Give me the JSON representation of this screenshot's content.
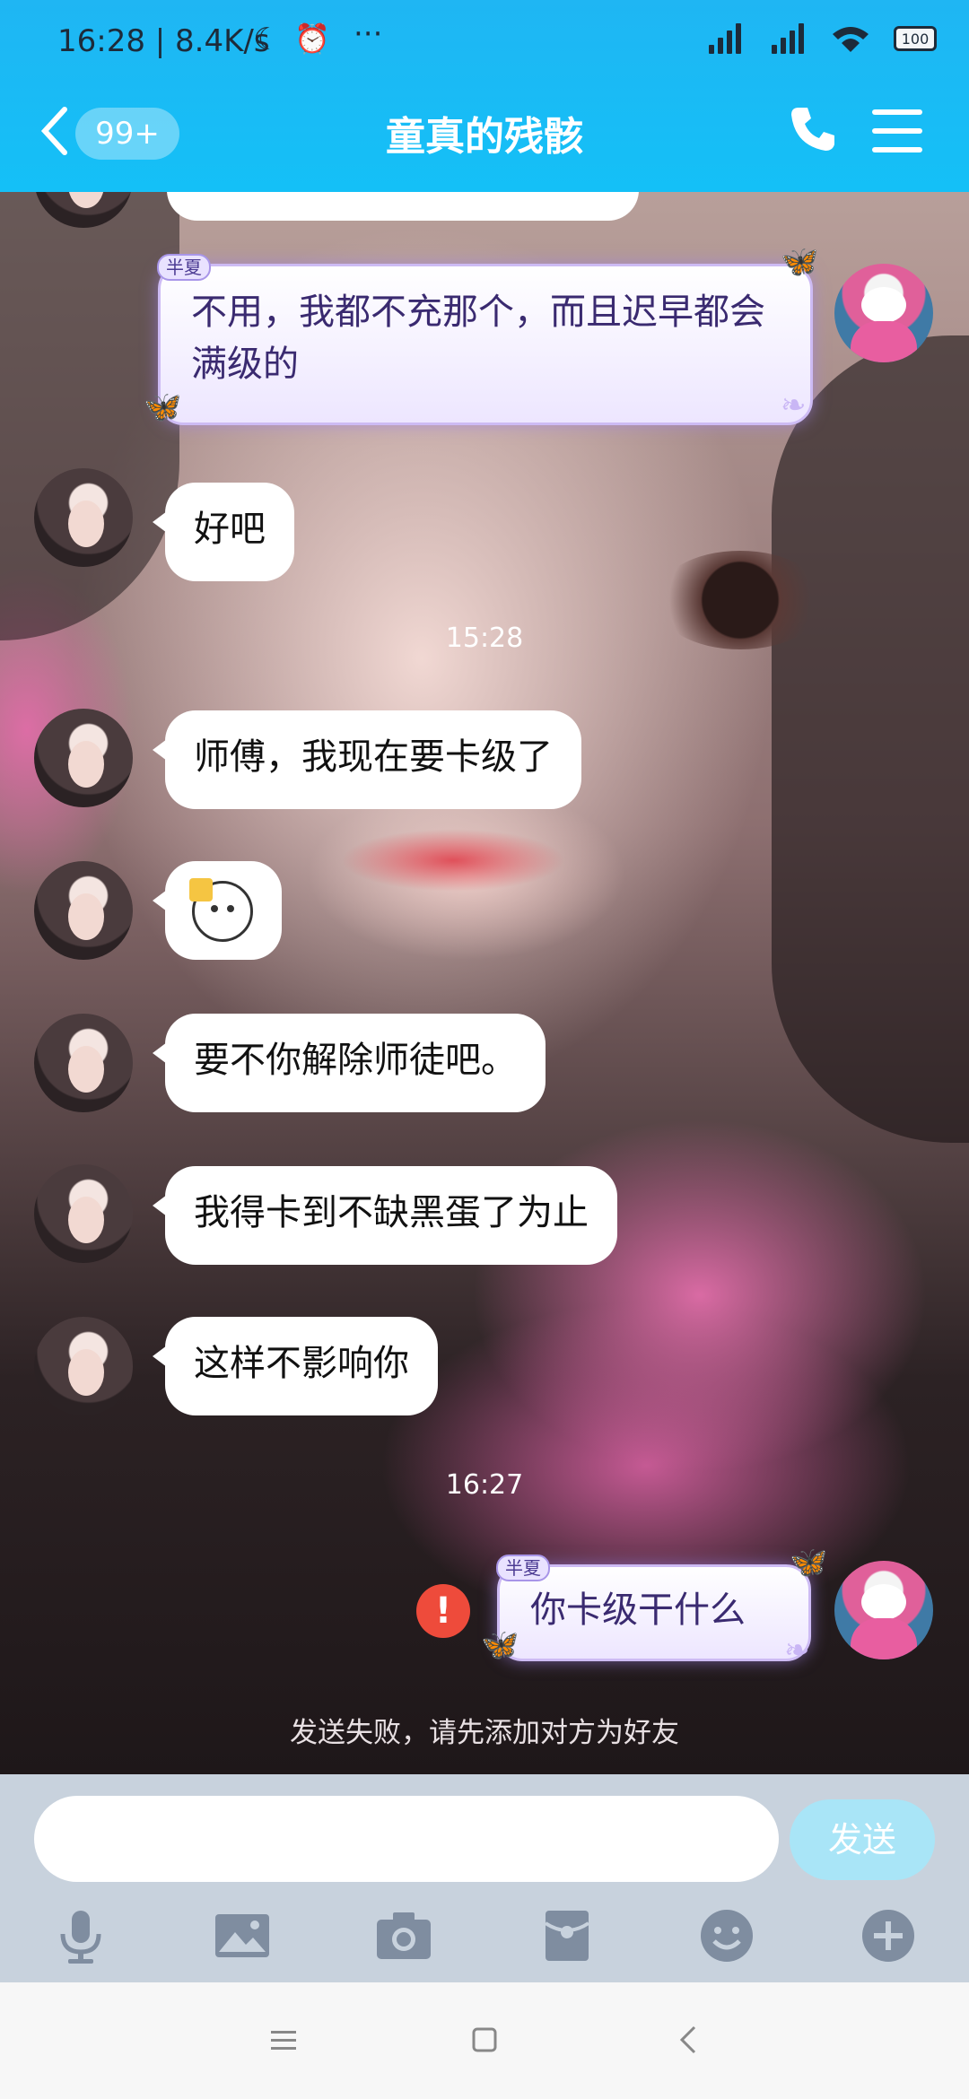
{
  "status_bar": {
    "time": "16:28 | 8.4K/s",
    "battery": "100"
  },
  "header": {
    "unread_badge": "99+",
    "title": "童真的残骸"
  },
  "messages": [
    {
      "side": "right",
      "tag": "半夏",
      "text": "不用，我都不充那个，而且迟早都会满级的"
    },
    {
      "side": "left",
      "text": "好吧"
    },
    {
      "type": "time",
      "text": "15:28"
    },
    {
      "side": "left",
      "text": "师傅，我现在要卡级了"
    },
    {
      "side": "left",
      "type": "sticker"
    },
    {
      "side": "left",
      "text": "要不你解除师徒吧。"
    },
    {
      "side": "left",
      "text": "我得卡到不缺黑蛋了为止"
    },
    {
      "side": "left",
      "text": "这样不影响你"
    },
    {
      "type": "time",
      "text": "16:27"
    },
    {
      "side": "right",
      "tag": "半夏",
      "text": "你卡级干什么",
      "failed": true
    }
  ],
  "fail_notice": "发送失败，请先添加对方为好友",
  "input": {
    "value": "",
    "send_label": "发送"
  },
  "toolbar": [
    "mic-icon",
    "image-icon",
    "camera-icon",
    "red-packet-icon",
    "emoji-icon",
    "plus-icon"
  ],
  "colors": {
    "header": "#14c0f7",
    "fail": "#ee4b3b",
    "send_disabled": "#a9e5f7"
  }
}
